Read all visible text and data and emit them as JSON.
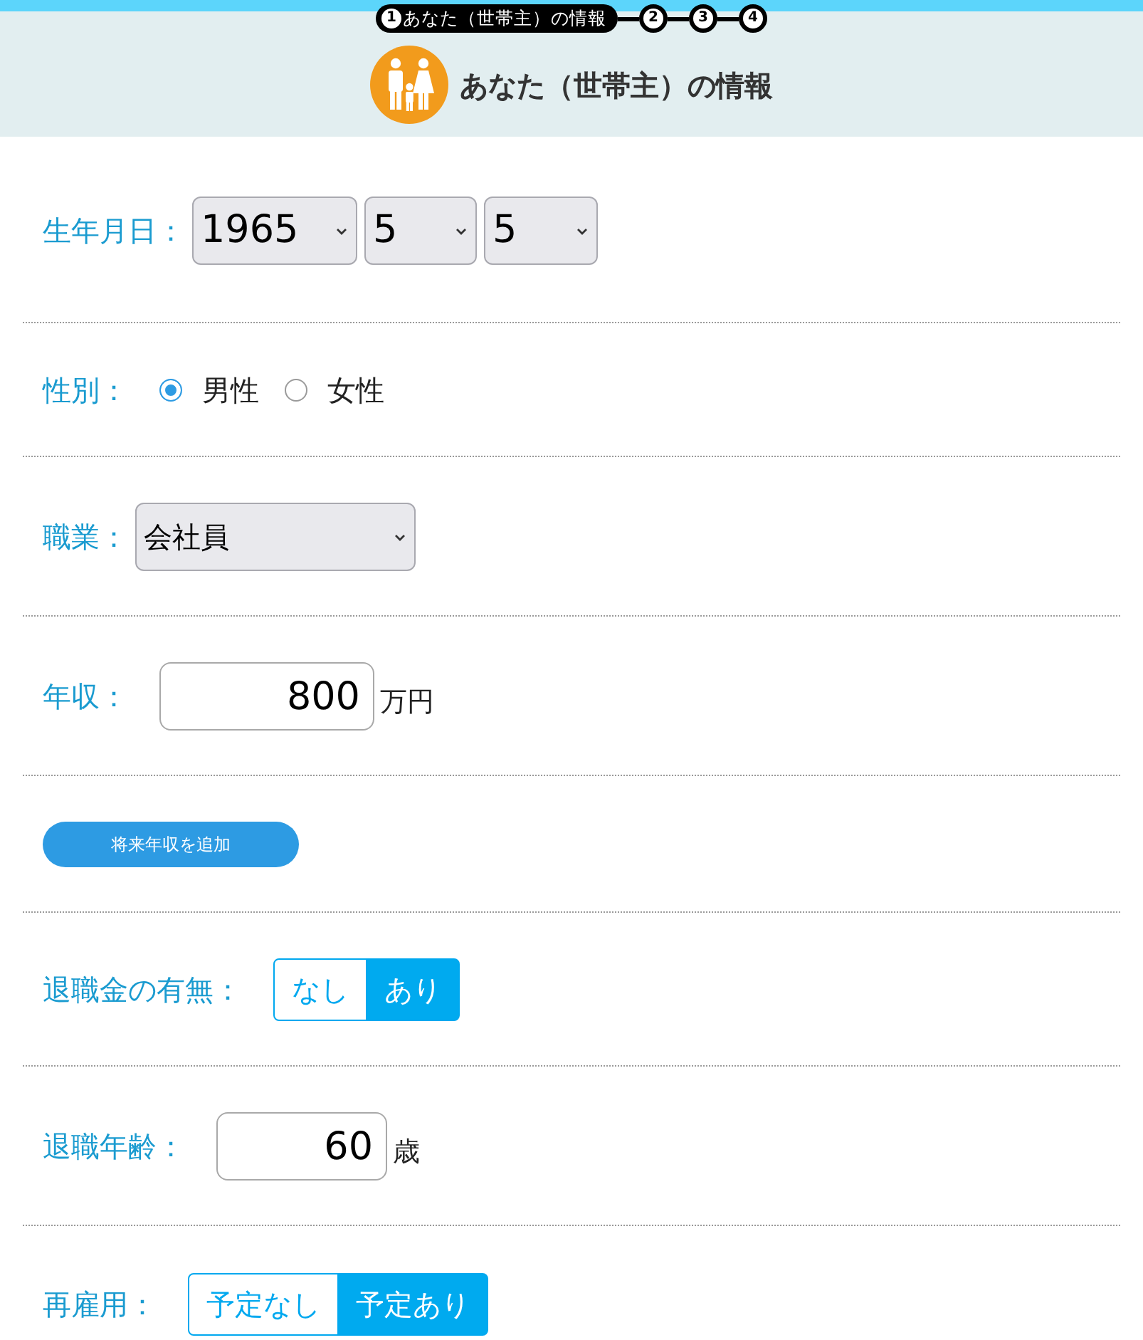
{
  "progress": {
    "steps": [
      {
        "number": "1",
        "label": "あなた（世帯主）の情報",
        "selected": true
      },
      {
        "number": "2",
        "selected": false
      },
      {
        "number": "3",
        "selected": false
      },
      {
        "number": "4",
        "selected": false
      }
    ]
  },
  "header": {
    "title": "あなた（世帯主）の情報"
  },
  "fields": [
    {
      "kind": "date",
      "label": "生年月日：",
      "values": [
        "1965",
        "5",
        "5"
      ]
    },
    {
      "kind": "radio",
      "label": "性別：",
      "options": [
        {
          "label": "男性",
          "selected": true
        },
        {
          "label": "女性",
          "selected": false
        }
      ]
    },
    {
      "kind": "select",
      "label": "職業：",
      "value": "会社員"
    },
    {
      "kind": "number",
      "label": "年収：",
      "value": "800",
      "unit": "万円"
    },
    {
      "kind": "button",
      "label": "将来年収を追加"
    },
    {
      "kind": "toggle",
      "label": "退職金の有無：",
      "options": [
        {
          "label": "なし",
          "selected": false
        },
        {
          "label": "あり",
          "selected": true
        }
      ]
    },
    {
      "kind": "number",
      "label": "退職年齢：",
      "value": "60",
      "unit": "歳"
    },
    {
      "kind": "toggle",
      "label": "再雇用：",
      "options": [
        {
          "label": "予定なし",
          "selected": false
        },
        {
          "label": "予定あり",
          "selected": true
        }
      ]
    }
  ]
}
